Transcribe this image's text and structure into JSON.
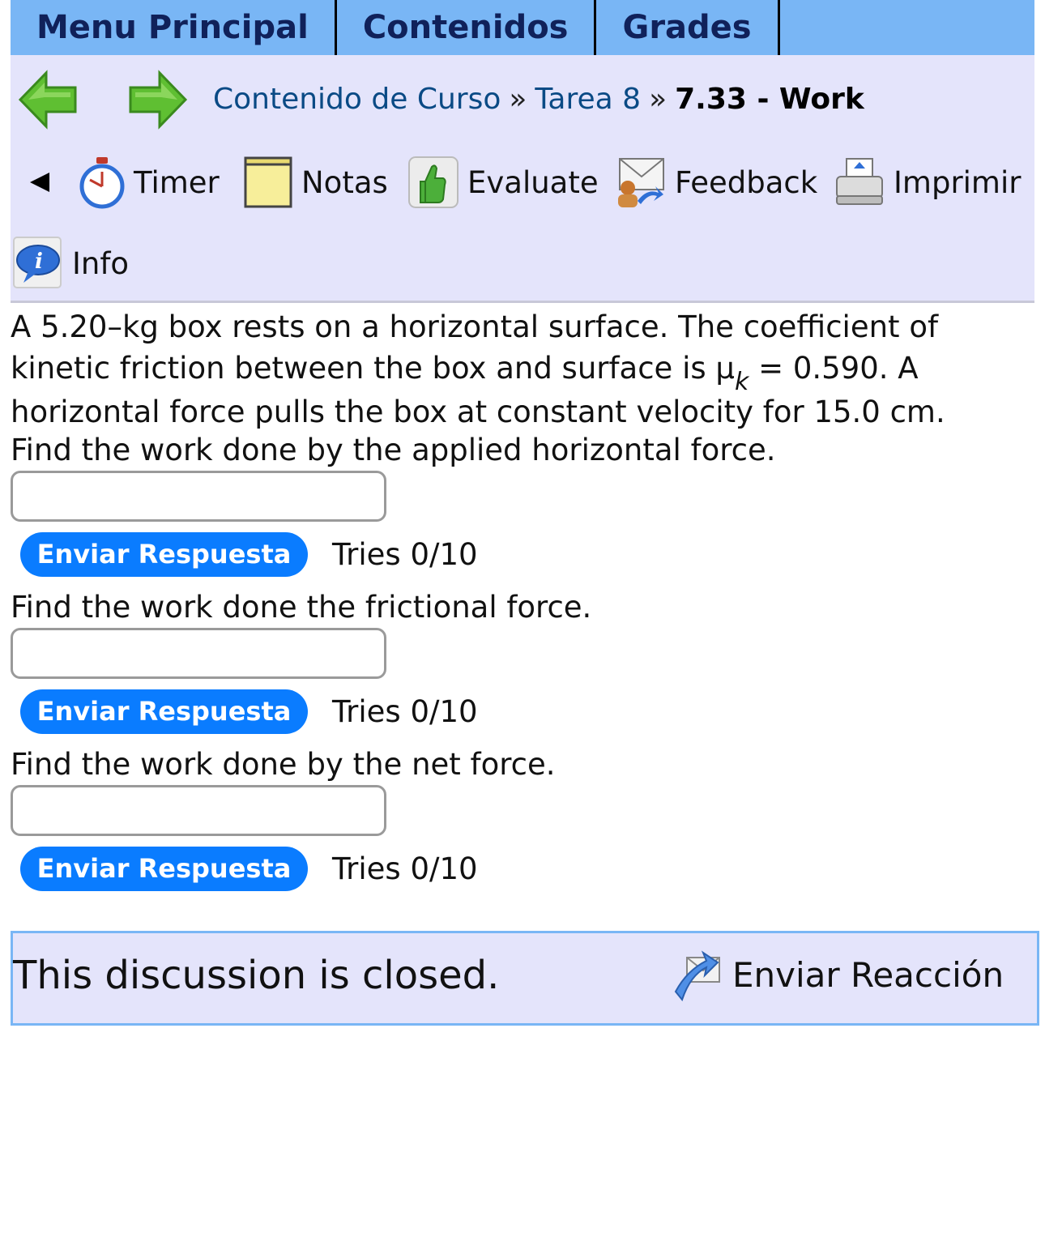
{
  "top_menu": {
    "items": [
      "Menu Principal",
      "Contenidos",
      "Grades"
    ]
  },
  "nav": {
    "back_icon": "green-left-arrow-icon",
    "forward_icon": "green-right-arrow-icon",
    "breadcrumb": {
      "link1": "Contenido de Curso",
      "sep": "»",
      "link2": "Tarea 8",
      "current": "7.33 - Work"
    },
    "tools": {
      "timer": "Timer",
      "notas": "Notas",
      "evaluate": "Evaluate",
      "feedback": "Feedback",
      "imprimir": "Imprimir",
      "info": "Info"
    }
  },
  "problem": {
    "intro_part1": "A 5.20–kg box rests on a horizontal surface. The coefficient of kinetic friction between the box and surface is μ",
    "intro_sub": "k",
    "intro_part2": " = 0.590. A horizontal force pulls the box at constant velocity for 15.0 cm.",
    "parts": [
      {
        "question": "Find the work done by the applied horizontal force.",
        "value": "",
        "submit": "Enviar Respuesta",
        "tries": "Tries 0/10"
      },
      {
        "question": "Find the work done the frictional force.",
        "value": "",
        "submit": "Enviar Respuesta",
        "tries": "Tries 0/10"
      },
      {
        "question": "Find the work done by the net force.",
        "value": "",
        "submit": "Enviar Respuesta",
        "tries": "Tries 0/10"
      }
    ]
  },
  "discussion": {
    "status": "This discussion is closed.",
    "react_label": "Enviar Reacción"
  },
  "colors": {
    "menu_bar": "#79b6f5",
    "nav_panel": "#e4e4fb",
    "submit_button": "#0a7cff",
    "link": "#0a4a85"
  }
}
